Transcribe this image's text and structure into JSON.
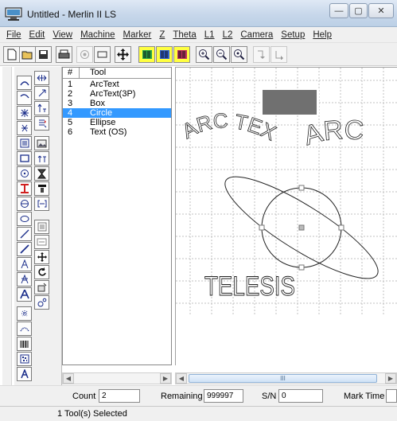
{
  "window": {
    "title": "Untitled - Merlin II LS",
    "minimize_label": "—",
    "maximize_label": "▢",
    "close_label": "✕"
  },
  "menu": {
    "items": [
      "File",
      "Edit",
      "View",
      "Machine",
      "Marker",
      "Z",
      "Theta",
      "L1",
      "L2",
      "Camera",
      "Setup",
      "Help"
    ]
  },
  "toolbar": {
    "buttons": [
      "new-icon",
      "open-icon",
      "save-icon",
      "print-icon",
      "circle-target-icon",
      "rectangle-icon",
      "move-icon",
      "barcode-color-1-icon",
      "barcode-color-2-icon",
      "barcode-color-3-icon",
      "zoom-in-icon",
      "zoom-out-icon",
      "zoom-fit-icon",
      "step-right-icon",
      "step-down-icon"
    ]
  },
  "tool_list": {
    "headers": {
      "number": "#",
      "tool": "Tool"
    },
    "rows": [
      {
        "number": "1",
        "tool": "ArcText",
        "selected": false
      },
      {
        "number": "2",
        "tool": "ArcText(3P)",
        "selected": false
      },
      {
        "number": "3",
        "tool": "Box",
        "selected": false
      },
      {
        "number": "4",
        "tool": "Circle",
        "selected": true
      },
      {
        "number": "5",
        "tool": "Ellipse",
        "selected": false
      },
      {
        "number": "6",
        "tool": "Text (OS)",
        "selected": false
      }
    ]
  },
  "canvas": {
    "arc_text_left": "ARC TEXT",
    "arc_text_right": "ARC",
    "telesis_text": "TELESIS",
    "scroll_thumb_label": "III"
  },
  "status": {
    "count_label": "Count",
    "count_value": "2",
    "remaining_label": "Remaining",
    "remaining_value": "999997",
    "sn_label": "S/N",
    "sn_value": "0",
    "mark_time_label": "Mark Time",
    "mark_time_value": "",
    "bottom_text": "1 Tool(s) Selected"
  },
  "colors": {
    "selection": "#3399ff",
    "palette_icon": "#1a2d8a",
    "red_tool": "#d02020"
  }
}
